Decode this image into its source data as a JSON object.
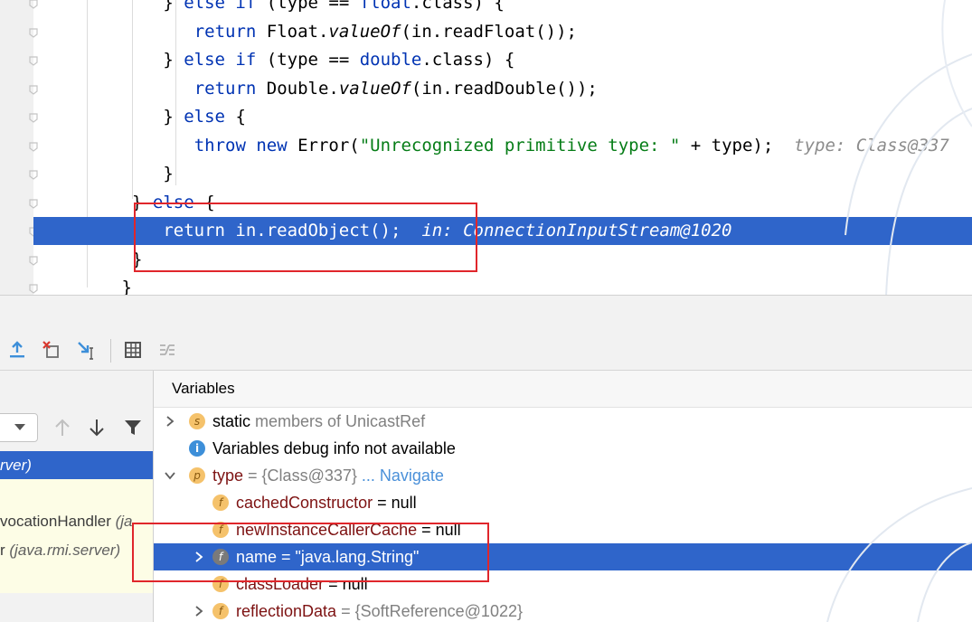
{
  "editor": {
    "lines": [
      {
        "indent": "    ",
        "parts": [
          [
            "",
            "} "
          ],
          [
            "kw",
            "else if"
          ],
          [
            "",
            " (type == "
          ],
          [
            "kw",
            "float"
          ],
          [
            "",
            ".class) {"
          ]
        ]
      },
      {
        "indent": "       ",
        "parts": [
          [
            "kw",
            "return"
          ],
          [
            "",
            " Float."
          ],
          [
            "it",
            "valueOf"
          ],
          [
            "",
            "(in.readFloat());"
          ]
        ]
      },
      {
        "indent": "    ",
        "parts": [
          [
            "",
            "} "
          ],
          [
            "kw",
            "else if"
          ],
          [
            "",
            " (type == "
          ],
          [
            "kw",
            "double"
          ],
          [
            "",
            ".class) {"
          ]
        ]
      },
      {
        "indent": "       ",
        "parts": [
          [
            "kw",
            "return"
          ],
          [
            "",
            " Double."
          ],
          [
            "it",
            "valueOf"
          ],
          [
            "",
            "(in.readDouble());"
          ]
        ]
      },
      {
        "indent": "    ",
        "parts": [
          [
            "",
            "} "
          ],
          [
            "kw",
            "else"
          ],
          [
            "",
            " {"
          ]
        ]
      },
      {
        "indent": "       ",
        "parts": [
          [
            "kw",
            "throw new"
          ],
          [
            "",
            " Error("
          ],
          [
            "str",
            "\"Unrecognized primitive type: \""
          ],
          [
            "",
            " + type);  "
          ],
          [
            "hint",
            "type: Class@337"
          ]
        ]
      },
      {
        "indent": "    ",
        "parts": [
          [
            "",
            "}"
          ]
        ]
      },
      {
        "indent": " ",
        "parts": [
          [
            "",
            "} "
          ],
          [
            "kw",
            "else"
          ],
          [
            "",
            " {"
          ]
        ]
      },
      {
        "indent": "    ",
        "parts": [
          [
            "",
            "return in.readObject();  "
          ],
          [
            "hint",
            "in: ConnectionInputStream@1020"
          ]
        ]
      },
      {
        "indent": " ",
        "parts": [
          [
            "",
            "}"
          ]
        ]
      },
      {
        "indent": "",
        "parts": [
          [
            "",
            "}"
          ]
        ]
      }
    ]
  },
  "toolbar": {
    "icons": [
      "step-out-icon",
      "drop-frame-icon",
      "run-to-cursor-icon",
      "evaluate-expression-icon",
      "trace-stream-icon"
    ]
  },
  "frames": {
    "items": [
      {
        "text": "rver)",
        "style": "sel"
      },
      {
        "text": "",
        "style": "yellow"
      },
      {
        "text": "vocationHandler ",
        "pkg": "(ja",
        "style": "yellow"
      },
      {
        "text": "r ",
        "pkg": "(java.rmi.server)",
        "style": "yellow"
      }
    ]
  },
  "variables": {
    "header": "Variables",
    "rows": [
      {
        "arrow": "right",
        "badge": "s",
        "name": "static",
        "rest": " members of UnicastRef",
        "rest_class": "gray",
        "level": 0
      },
      {
        "arrow": "",
        "badge": "i",
        "name": "",
        "rest": "Variables debug info not available",
        "rest_class": "plain",
        "level": 0
      },
      {
        "arrow": "down",
        "badge": "p",
        "name": "type",
        "rest": " = {Class@337} ",
        "rest_class": "gray",
        "link": "... Navigate",
        "level": 0
      },
      {
        "arrow": "",
        "badge": "f",
        "name": "cachedConstructor",
        "rest": " = null",
        "rest_class": "plain",
        "level": 1
      },
      {
        "arrow": "",
        "badge": "f",
        "name": "newInstanceCallerCache",
        "rest": " = null",
        "rest_class": "plain",
        "level": 1
      },
      {
        "arrow": "right",
        "badge": "f",
        "name": "name",
        "rest": " = \"java.lang.String\"",
        "rest_class": "plain",
        "level": 1,
        "selected": true
      },
      {
        "arrow": "",
        "badge": "f",
        "name": "classLoader",
        "rest": " = null",
        "rest_class": "plain",
        "level": 1
      },
      {
        "arrow": "right",
        "badge": "f",
        "name": "reflectionData",
        "rest": " = {SoftReference@1022}",
        "rest_class": "gray",
        "level": 1
      }
    ]
  },
  "colors": {
    "selection": "#2f65ca",
    "highlight_box": "#e0262b",
    "keyword": "#0033b3",
    "string": "#067d17"
  }
}
